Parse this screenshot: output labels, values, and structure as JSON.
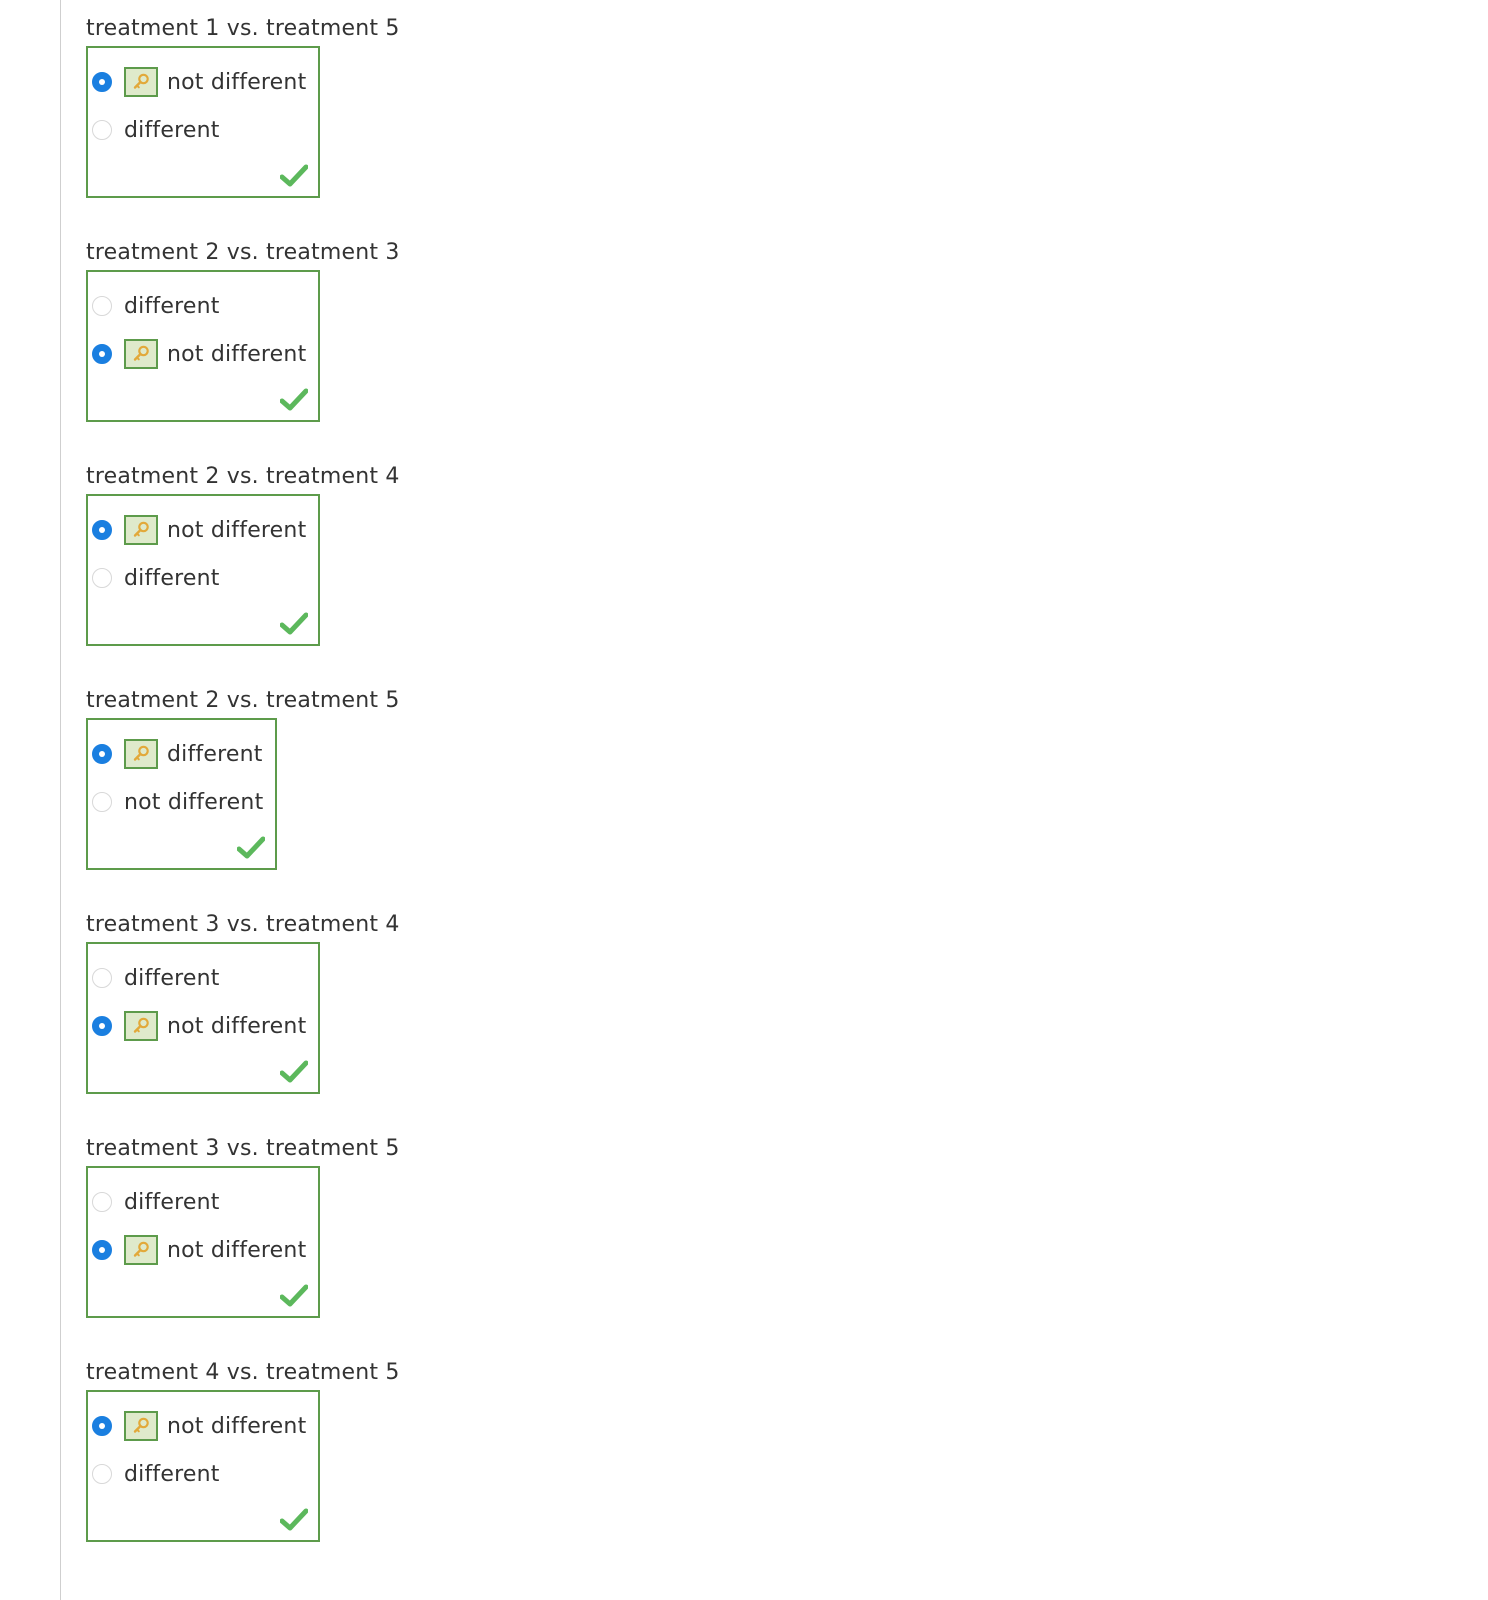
{
  "questions": [
    {
      "title": "treatment 1 vs. treatment 5",
      "options": [
        {
          "label": "not different",
          "selected": true
        },
        {
          "label": "different",
          "selected": false
        }
      ],
      "status": "correct"
    },
    {
      "title": "treatment 2 vs. treatment 3",
      "options": [
        {
          "label": "different",
          "selected": false
        },
        {
          "label": "not different",
          "selected": true
        }
      ],
      "status": "correct"
    },
    {
      "title": "treatment 2 vs. treatment 4",
      "options": [
        {
          "label": "not different",
          "selected": true
        },
        {
          "label": "different",
          "selected": false
        }
      ],
      "status": "correct"
    },
    {
      "title": "treatment 2 vs. treatment 5",
      "options": [
        {
          "label": "different",
          "selected": true
        },
        {
          "label": "not different",
          "selected": false
        }
      ],
      "status": "correct"
    },
    {
      "title": "treatment 3 vs. treatment 4",
      "options": [
        {
          "label": "different",
          "selected": false
        },
        {
          "label": "not different",
          "selected": true
        }
      ],
      "status": "correct"
    },
    {
      "title": "treatment 3 vs. treatment 5",
      "options": [
        {
          "label": "different",
          "selected": false
        },
        {
          "label": "not different",
          "selected": true
        }
      ],
      "status": "correct"
    },
    {
      "title": "treatment 4 vs. treatment 5",
      "options": [
        {
          "label": "not different",
          "selected": true
        },
        {
          "label": "different",
          "selected": false
        }
      ],
      "status": "correct"
    }
  ],
  "icons": {
    "answer_key": "key-icon",
    "correct": "checkmark-icon"
  },
  "colors": {
    "radio_selected": "#1a7fe0",
    "correct_border": "#5d9b4b",
    "key_background": "#dfeacb",
    "check_green": "#5cb85c",
    "key_gold": "#e2a93a",
    "text": "#333333"
  }
}
